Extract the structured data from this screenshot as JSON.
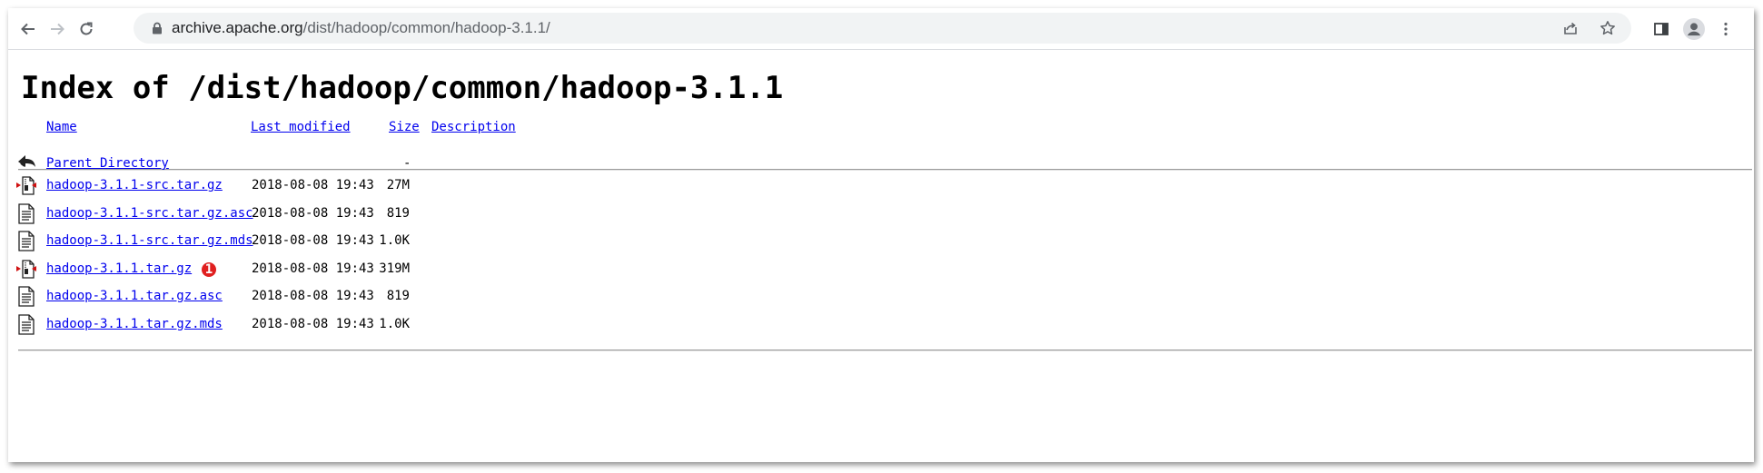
{
  "browser": {
    "url_host": "archive.apache.org",
    "url_path": "/dist/hadoop/common/hadoop-3.1.1/"
  },
  "page": {
    "title": "Index of /dist/hadoop/common/hadoop-3.1.1",
    "columns": {
      "name": "Name",
      "last_modified": "Last modified",
      "size": "Size",
      "description": "Description"
    },
    "parent": {
      "label": "Parent Directory",
      "size": "-"
    },
    "files": [
      {
        "name": "hadoop-3.1.1-src.tar.gz",
        "modified": "2018-08-08 19:43",
        "size": "27M",
        "icon": "compressed-file-icon"
      },
      {
        "name": "hadoop-3.1.1-src.tar.gz.asc",
        "modified": "2018-08-08 19:43",
        "size": "819",
        "icon": "text-file-icon"
      },
      {
        "name": "hadoop-3.1.1-src.tar.gz.mds",
        "modified": "2018-08-08 19:43",
        "size": "1.0K",
        "icon": "text-file-icon"
      },
      {
        "name": "hadoop-3.1.1.tar.gz",
        "modified": "2018-08-08 19:43",
        "size": "319M",
        "icon": "compressed-file-icon"
      },
      {
        "name": "hadoop-3.1.1.tar.gz.asc",
        "modified": "2018-08-08 19:43",
        "size": "819",
        "icon": "text-file-icon"
      },
      {
        "name": "hadoop-3.1.1.tar.gz.mds",
        "modified": "2018-08-08 19:43",
        "size": "1.0K",
        "icon": "text-file-icon"
      }
    ],
    "annotation_badge": "1"
  },
  "colors": {
    "link": "#0000ee",
    "badge": "#e02020"
  }
}
